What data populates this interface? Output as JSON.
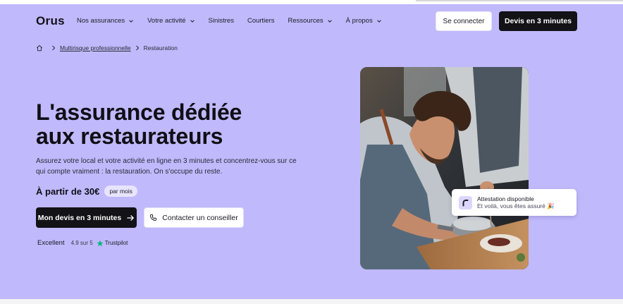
{
  "brand": "Orus",
  "nav": {
    "items": [
      {
        "label": "Nos assurances",
        "dropdown": true
      },
      {
        "label": "Votre activité",
        "dropdown": true
      },
      {
        "label": "Sinistres",
        "dropdown": false
      },
      {
        "label": "Courtiers",
        "dropdown": false
      },
      {
        "label": "Ressources",
        "dropdown": true
      },
      {
        "label": "À propos",
        "dropdown": true
      }
    ],
    "login_label": "Se connecter",
    "quote_label": "Devis en 3 minutes"
  },
  "breadcrumb": {
    "home_icon": "home-icon",
    "parent": "Multirisque professionnelle",
    "current": "Restauration"
  },
  "hero": {
    "title_line1": "L'assurance dédiée",
    "title_line2": "aux restaurateurs",
    "description": "Assurez votre local et votre activité en ligne en 3 minutes et concentrez-vous sur ce qui compte vraiment : la restauration. On s'occupe du reste.",
    "price": "À partir de 30€",
    "price_period": "par mois",
    "cta_quote": "Mon devis en 3 minutes",
    "cta_contact": "Contacter un conseiller",
    "rating_label": "Excellent",
    "rating_score": "4.9 sur 5",
    "rating_source": "Trustpilot"
  },
  "notification": {
    "title": "Attestation disponible",
    "subtitle": "Et voilà, vous êtes assuré 🎉"
  },
  "colors": {
    "hero_bg": "#c0b9fb",
    "dark": "#121217",
    "trustpilot": "#00b67a",
    "notif_icon_bg": "#dcd6fd"
  }
}
